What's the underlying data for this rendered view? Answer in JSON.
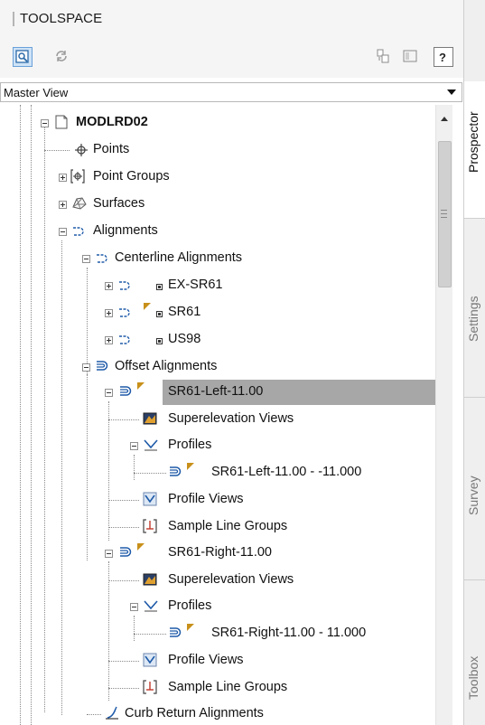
{
  "panel": {
    "title": "TOOLSPACE"
  },
  "view_selector": {
    "value": "Master View"
  },
  "tree": {
    "root": "MODLRD02",
    "points": "Points",
    "point_groups": "Point Groups",
    "surfaces": "Surfaces",
    "alignments": "Alignments",
    "centerline_alignments": "Centerline Alignments",
    "cl_items": [
      "EX-SR61",
      "SR61",
      "US98"
    ],
    "offset_alignments": "Offset Alignments",
    "left": {
      "name": "SR61-Left-11.00",
      "superelevation_views": "Superelevation Views",
      "profiles": "Profiles",
      "profile_item": "SR61-Left-11.00 - -11.000",
      "profile_views": "Profile Views",
      "sample_line_groups": "Sample Line Groups"
    },
    "right": {
      "name": "SR61-Right-11.00",
      "superelevation_views": "Superelevation Views",
      "profiles": "Profiles",
      "profile_item": "SR61-Right-11.00 - 11.000",
      "profile_views": "Profile Views",
      "sample_line_groups": "Sample Line Groups"
    },
    "curb_return_alignments": "Curb Return Alignments"
  },
  "side_tabs": [
    "Prospector",
    "Settings",
    "Survey",
    "Toolbox"
  ],
  "colors": {
    "selection": "#a7a7a7",
    "alignment_icon": "#1e5aa8",
    "marker": "#c8901a"
  }
}
